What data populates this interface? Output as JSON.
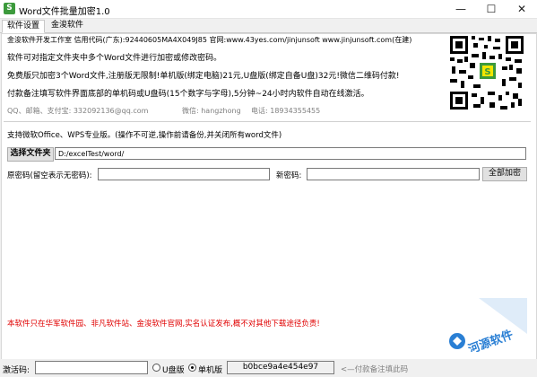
{
  "window": {
    "icon_letter": "S",
    "title": "Word文件批量加密1.0",
    "minimize": "—",
    "maximize": "☐",
    "close": "✕"
  },
  "tabs": [
    "软件设置",
    "金浚软件"
  ],
  "info": {
    "line1": "金浚软件开发工作室 信用代码(广东):92440605MA4X049J85 官网:www.43yes.com/jinjunsoft  www.jinjunsoft.com(在建)",
    "line2": "软件可对指定文件夹中多个Word文件进行加密或修改密码。",
    "line3": "免费版只加密3个Word文件,注册版无限制!单机版(绑定电脑)21元,U盘版(绑定自备U盘)32元!微信二维码付款!",
    "line4": "付款备注填写软件界面底部的单机码或U盘码(15个数字与字母),5分钟~24小时内软件自动在线激活。",
    "contact_qq": "QQ、邮箱、支付宝: 332092136@qq.com",
    "contact_wechat": "微信: hangzhong",
    "contact_phone": "电话: 18934355455"
  },
  "support_note": "支持微软Office、WPS专业版。(操作不可逆,操作前请备份,并关闭所有word文件)",
  "folder": {
    "button": "选择文件夹",
    "path": "D:/excelTest/word/"
  },
  "password": {
    "old_label": "原密码(留空表示无密码):",
    "old_value": "",
    "new_label": "新密码:",
    "new_value": "",
    "encrypt_all": "全部加密"
  },
  "notice": "本软件只在华军软件园、非凡软件站、金浚软件官网,实名认证发布,概不对其他下载途径负责!",
  "watermark": "河源软件",
  "status": {
    "activation_label": "激活码:",
    "activation_value": "",
    "usb_option": "U盘版",
    "pc_option": "单机版",
    "selected": "单机版",
    "machine_code": "b0bce9a4e454e97",
    "hint": "<—付款备注填此码"
  },
  "colors": {
    "red": "#e00000",
    "watermark_blue": "#2a7fd4"
  }
}
